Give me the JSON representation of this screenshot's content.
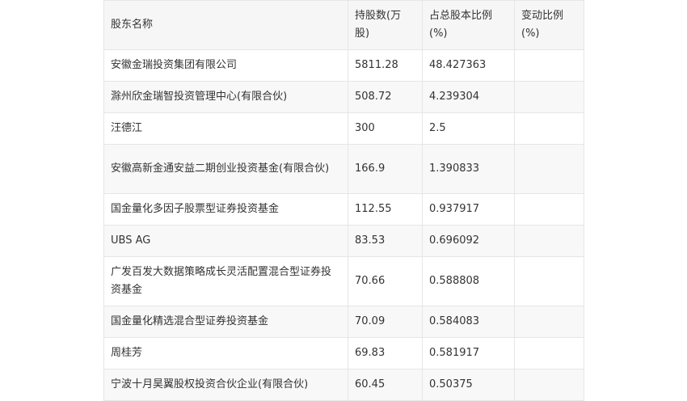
{
  "table": {
    "headers": {
      "name": "股东名称",
      "shares": "持股数(万股)",
      "ratio": "占总股本比例(%)",
      "change": "变动比例(%)"
    },
    "rows": [
      {
        "name": "安徽金瑞投资集团有限公司",
        "shares": "5811.28",
        "ratio": "48.427363",
        "change": ""
      },
      {
        "name": "滁州欣金瑞智投资管理中心(有限合伙)",
        "shares": "508.72",
        "ratio": "4.239304",
        "change": ""
      },
      {
        "name": "汪德江",
        "shares": "300",
        "ratio": "2.5",
        "change": ""
      },
      {
        "name": "安徽高新金通安益二期创业投资基金(有限合伙)",
        "shares": "166.9",
        "ratio": "1.390833",
        "change": ""
      },
      {
        "name": "国金量化多因子股票型证券投资基金",
        "shares": "112.55",
        "ratio": "0.937917",
        "change": ""
      },
      {
        "name": "UBS AG",
        "shares": "83.53",
        "ratio": "0.696092",
        "change": ""
      },
      {
        "name": "广发百发大数据策略成长灵活配置混合型证券投资基金",
        "shares": "70.66",
        "ratio": "0.588808",
        "change": ""
      },
      {
        "name": "国金量化精选混合型证券投资基金",
        "shares": "70.09",
        "ratio": "0.584083",
        "change": ""
      },
      {
        "name": "周桂芳",
        "shares": "69.83",
        "ratio": "0.581917",
        "change": ""
      },
      {
        "name": "宁波十月昊翼股权投资合伙企业(有限合伙)",
        "shares": "60.45",
        "ratio": "0.50375",
        "change": ""
      }
    ]
  }
}
